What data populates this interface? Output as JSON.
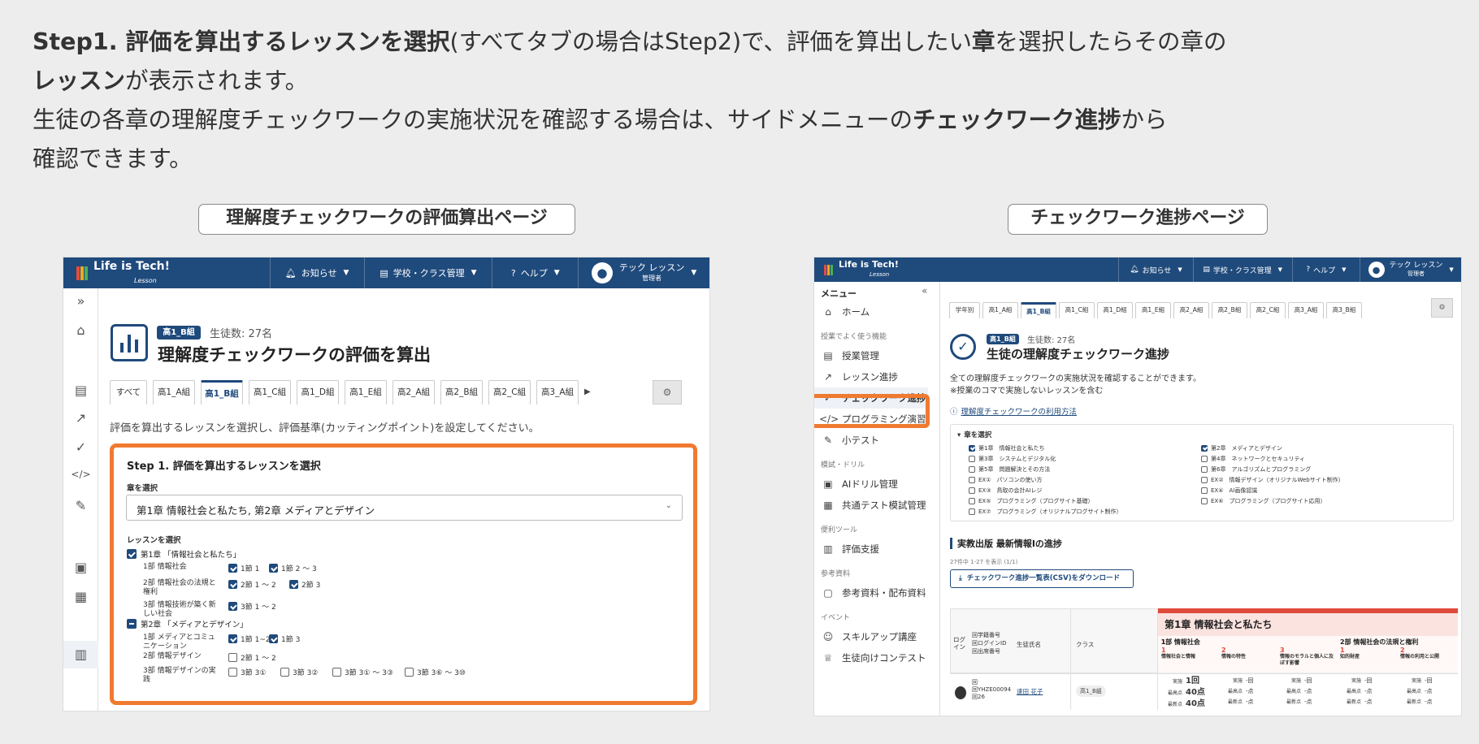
{
  "intro": {
    "l1_b1": "Step1. 評価を算出するレッスンを選択",
    "l1_t1": "(すべてタブの場合はStep2)で、評価を算出したい",
    "l1_b2": "章",
    "l1_t2": "を選択したらその章の",
    "l2_b1": "レッスン",
    "l2_t1": "が表示されます。",
    "l3_t1": "生徒の各章の理解度チェックワークの実施状況を確認する場合は、サイドメニューの",
    "l3_b1": "チェックワーク進捗",
    "l3_t2": "から",
    "l4_t1": "確認できます。"
  },
  "captions": {
    "left": "理解度チェックワークの評価算出ページ",
    "right": "チェックワーク進捗ページ"
  },
  "header": {
    "logo": "Life is Tech!",
    "logo_sub": "Lesson",
    "notice": "お知らせ",
    "school": "学校・クラス管理",
    "help": "ヘルプ",
    "user": "テック レッスン",
    "role": "管理者"
  },
  "left": {
    "class_badge": "高1_B組",
    "students": "生徒数: 27名",
    "title": "理解度チェックワークの評価を算出",
    "tabs": [
      "すべて",
      "高1_A組",
      "高1_B組",
      "高1_C組",
      "高1_D組",
      "高1_E組",
      "高2_A組",
      "高2_B組",
      "高2_C組",
      "高3_A組"
    ],
    "desc": "評価を算出するレッスンを選択し、評価基準(カッティングポイント)を設定してください。",
    "step_title": "Step 1. 評価を算出するレッスンを選択",
    "chapter_label": "章を選択",
    "chapter_value": "第1章 情報社会と私たち,  第2章 メディアとデザイン",
    "lesson_label": "レッスンを選択",
    "ch1": "第1章 「情報社会と私たち」",
    "ch2": "第2章 「メディアとデザイン」",
    "rows": [
      {
        "name": "1部 情報社会",
        "opts": [
          {
            "t": "1節 1",
            "c": true
          },
          {
            "t": "1節 2 〜 3",
            "c": true
          }
        ]
      },
      {
        "name": "2部 情報社会の法規と権利",
        "opts": [
          {
            "t": "2節 1 〜 2",
            "c": true
          },
          {
            "t": "2節 3",
            "c": true
          }
        ]
      },
      {
        "name": "3部 情報技術が築く新しい社会",
        "opts": [
          {
            "t": "3節 1 〜 2",
            "c": true
          }
        ]
      },
      {
        "name": "1部 メディアとコミュニケーション",
        "opts": [
          {
            "t": "1節 1~2",
            "c": true
          },
          {
            "t": "1節 3",
            "c": true
          }
        ]
      },
      {
        "name": "2部 情報デザイン",
        "opts": [
          {
            "t": "2節 1 〜 2",
            "c": false
          }
        ]
      },
      {
        "name": "3部 情報デザインの実践",
        "opts": [
          {
            "t": "3節 3①",
            "c": false
          },
          {
            "t": "3節 3②",
            "c": false
          },
          {
            "t": "3節 3① 〜 3③",
            "c": false
          },
          {
            "t": "3節 3⑥ 〜 3⑩",
            "c": false
          }
        ]
      }
    ]
  },
  "right": {
    "menu_title": "メニュー",
    "menu": [
      {
        "type": "item",
        "label": "ホーム",
        "icon": "home-icon",
        "g": "⌂"
      },
      {
        "type": "sec",
        "label": "授業でよく使う機能"
      },
      {
        "type": "item",
        "label": "授業管理",
        "icon": "class-icon",
        "g": "▤"
      },
      {
        "type": "item",
        "label": "レッスン進捗",
        "icon": "trend-icon",
        "g": "↗"
      },
      {
        "type": "item",
        "label": "チェックワーク進捗",
        "icon": "check-icon",
        "g": "✓",
        "active": true
      },
      {
        "type": "item",
        "label": "プログラミング演習",
        "icon": "code-icon",
        "g": "</>"
      },
      {
        "type": "item",
        "label": "小テスト",
        "icon": "pen-icon",
        "g": "✎"
      },
      {
        "type": "sec",
        "label": "模試・ドリル"
      },
      {
        "type": "item",
        "label": "AIドリル管理",
        "icon": "drill-icon",
        "g": "▣"
      },
      {
        "type": "item",
        "label": "共通テスト模試管理",
        "icon": "exam-icon",
        "g": "▦"
      },
      {
        "type": "sec",
        "label": "便利ツール"
      },
      {
        "type": "item",
        "label": "評価支援",
        "icon": "chart-icon",
        "g": "▥"
      },
      {
        "type": "sec",
        "label": "参考資料"
      },
      {
        "type": "item",
        "label": "参考資料・配布資料",
        "icon": "doc-icon",
        "g": "▢"
      },
      {
        "type": "sec",
        "label": "イベント"
      },
      {
        "type": "item",
        "label": "スキルアップ講座",
        "icon": "smile-icon",
        "g": "☺"
      },
      {
        "type": "item",
        "label": "生徒向けコンテスト",
        "icon": "trophy-icon",
        "g": "♕"
      }
    ],
    "tabs": [
      "学年別",
      "高1_A組",
      "高1_B組",
      "高1_C組",
      "高1_D組",
      "高1_E組",
      "高2_A組",
      "高2_B組",
      "高2_C組",
      "高3_A組",
      "高3_B組"
    ],
    "class_badge": "高1_B組",
    "students": "生徒数: 27名",
    "title": "生徒の理解度チェックワーク進捗",
    "desc1": "全ての理解度チェックワークの実施状況を確認することができます。",
    "desc2": "※授業のコマで実施しないレッスンを含む",
    "help_link": "理解度チェックワークの利用方法",
    "chapter_toggle": "章を選択",
    "chapters_left": [
      {
        "t": "第1章　情報社会と私たち",
        "c": true
      },
      {
        "t": "第3章　システムとデジタル化",
        "c": false
      },
      {
        "t": "第5章　問題解決とその方法",
        "c": false
      },
      {
        "t": "EX①　パソコンの使い方",
        "c": false
      },
      {
        "t": "EX③　鳥取の会計AIレジ",
        "c": false
      },
      {
        "t": "EX⑤　プログラミング（プログサイト基礎）",
        "c": false
      },
      {
        "t": "EX⑦　プログラミング（オリジナルプログサイト制作）",
        "c": false
      }
    ],
    "chapters_right": [
      {
        "t": "第2章　メディアとデザイン",
        "c": true
      },
      {
        "t": "第4章　ネットワークとセキュリティ",
        "c": false
      },
      {
        "t": "第6章　アルゴリズムとプログラミング",
        "c": false
      },
      {
        "t": "EX②　情報デザイン（オリジナルWebサイト制作）",
        "c": false
      },
      {
        "t": "EX④　AI画像認識",
        "c": false
      },
      {
        "t": "EX⑥　プログラミング（プログサイト応用）",
        "c": false
      }
    ],
    "section_title": "実教出版 最新情報Iの進捗",
    "count_text": "27件中 1-27 を表示 (1/1)",
    "download": "チェックワーク進捗一覧表(CSV)をダウンロード",
    "table": {
      "h_login": "ログイン",
      "h_ids": [
        "回学籍番号",
        "回ログインID",
        "回出席番号"
      ],
      "h_name": "生徒氏名",
      "h_class": "クラス",
      "chapter": "第1章  情報社会と私たち",
      "part1": "1部  情報社会",
      "part2": "2部  情報社会の法規と権利",
      "sub": [
        {
          "n": "1",
          "t": "情報社会と情報"
        },
        {
          "n": "2",
          "t": "情報の特性"
        },
        {
          "n": "3",
          "t": "情報のモラルと個人に及ぼす影響"
        },
        {
          "n": "1",
          "t": "知的財産"
        },
        {
          "n": "2",
          "t": "情報の利用と公開"
        }
      ],
      "row": {
        "ids": [
          "回",
          "回YHZE00094",
          "回26"
        ],
        "name": "速田 花子",
        "class": "高1_B組",
        "c1": {
          "k1": "実施",
          "v1": "1回",
          "k2": "最高点",
          "v2": "40点",
          "k3": "最新点",
          "v3": "40点"
        },
        "dash": {
          "k1": "実施",
          "v1": "-回",
          "k2": "最高点",
          "v2": "-点",
          "k3": "最新点",
          "v3": "-点"
        }
      }
    }
  },
  "colors": {
    "navy": "#1f4a7c",
    "orange": "#f07a30",
    "red": "#e04b3c",
    "bg": "#ededed"
  }
}
